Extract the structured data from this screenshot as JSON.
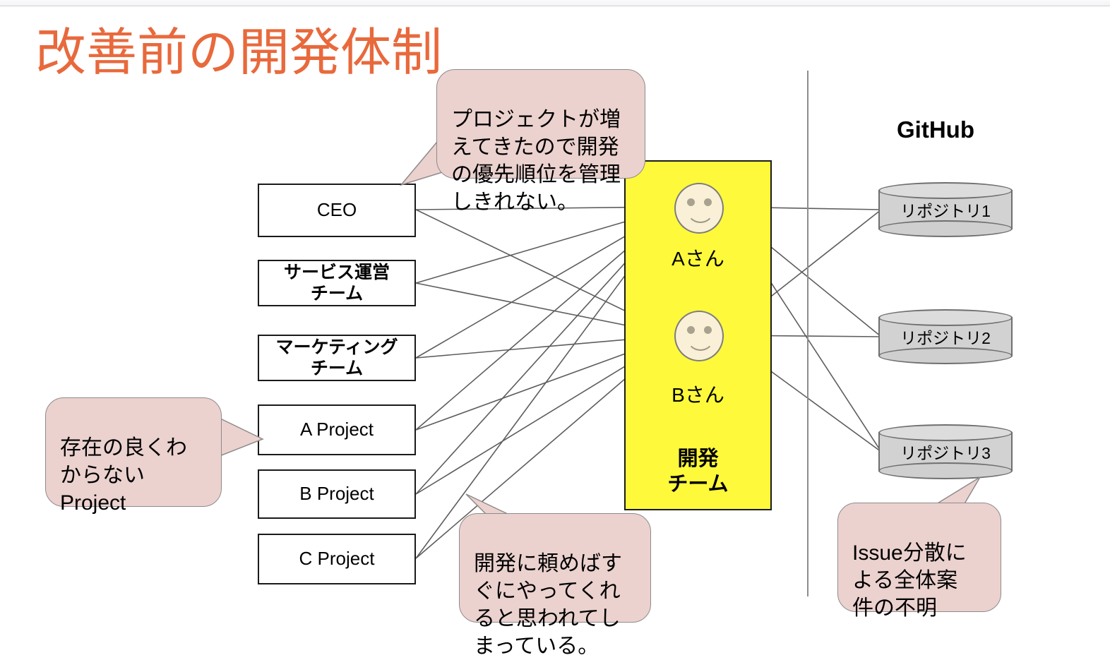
{
  "slide": {
    "title": "改善前の開発体制",
    "title_color": "#E8693C",
    "background": "#ffffff"
  },
  "org_boxes": [
    {
      "id": "ceo",
      "label": "CEO",
      "japanese": false
    },
    {
      "id": "service",
      "label": "サービス運営\nチーム",
      "japanese": true
    },
    {
      "id": "marketing",
      "label": "マーケティング\nチーム",
      "japanese": true
    },
    {
      "id": "project-a",
      "label": "A Project",
      "japanese": false
    },
    {
      "id": "project-b",
      "label": "B Project",
      "japanese": false
    },
    {
      "id": "project-c",
      "label": "C Project",
      "japanese": false
    }
  ],
  "dev_team": {
    "label": "開発\nチーム",
    "fill_color": "#FFF93B",
    "members": [
      {
        "id": "person-a",
        "name": "Aさん"
      },
      {
        "id": "person-b",
        "name": "Bさん"
      }
    ]
  },
  "github": {
    "title": "GitHub",
    "repositories": [
      {
        "id": "repo-1",
        "label": "リポジトリ1"
      },
      {
        "id": "repo-2",
        "label": "リポジトリ2"
      },
      {
        "id": "repo-3",
        "label": "リポジトリ3"
      }
    ]
  },
  "callouts": [
    {
      "id": "callout-top",
      "text": "プロジェクトが増\nえてきたので開発\nの優先順位を管理\nしきれない。",
      "fill_color": "#EBD2CF"
    },
    {
      "id": "callout-left",
      "text": "存在の良くわ\nからない\nProject",
      "fill_color": "#EBD2CF"
    },
    {
      "id": "callout-bottom",
      "text": "開発に頼めばす\nぐにやってくれ\nると思われてし\nまっている。",
      "fill_color": "#EBD2CF"
    },
    {
      "id": "callout-right",
      "text": "Issue分散に\nよる全体案\n件の不明",
      "fill_color": "#EBD2CF"
    }
  ]
}
